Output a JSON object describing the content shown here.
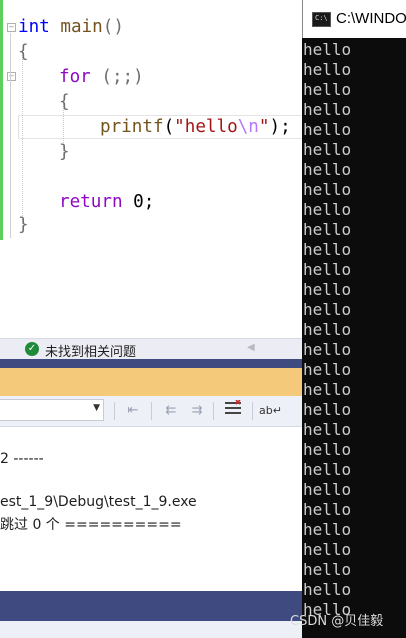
{
  "editor": {
    "lines": {
      "l1_kw": "int",
      "l1_fn": "main",
      "l1_rest": "()",
      "l2": "{",
      "l3_kw": "for",
      "l3_rest": " (;;)",
      "l4": "{",
      "l5_fn": "printf",
      "l5_open": "(",
      "l5_str1": "\"hello",
      "l5_esc": "\\n",
      "l5_str2": "\"",
      "l5_close": ");",
      "l6": "}",
      "l8_kw": "return",
      "l8_rest": " 0;",
      "l9": "}"
    }
  },
  "issues": {
    "icon": "check-circle-icon",
    "text": "未找到相关问题",
    "status_color": "#1e8a3a"
  },
  "output": {
    "lines": [
      "2 ------",
      "est_1_9\\Debug\\test_1_9.exe",
      "跳过 0 个 =========="
    ]
  },
  "console": {
    "title": "C:\\WINDO",
    "lines": [
      "hello",
      "hello",
      "hello",
      "hello",
      "hello",
      "hello",
      "hello",
      "hello",
      "hello",
      "hello",
      "hello",
      "hello",
      "hello",
      "hello",
      "hello",
      "hello",
      "hello",
      "hello",
      "hello",
      "hello",
      "hello",
      "hello",
      "hello",
      "hello",
      "hello",
      "hello",
      "hello",
      "hello",
      "hello"
    ]
  },
  "watermark": "CSDN @贝佳毅",
  "colors": {
    "accent_green": "#5ccf5c",
    "header_orange": "#f5c97a",
    "dark_strip": "#3f4a80",
    "console_bg": "#0c0c0c"
  }
}
